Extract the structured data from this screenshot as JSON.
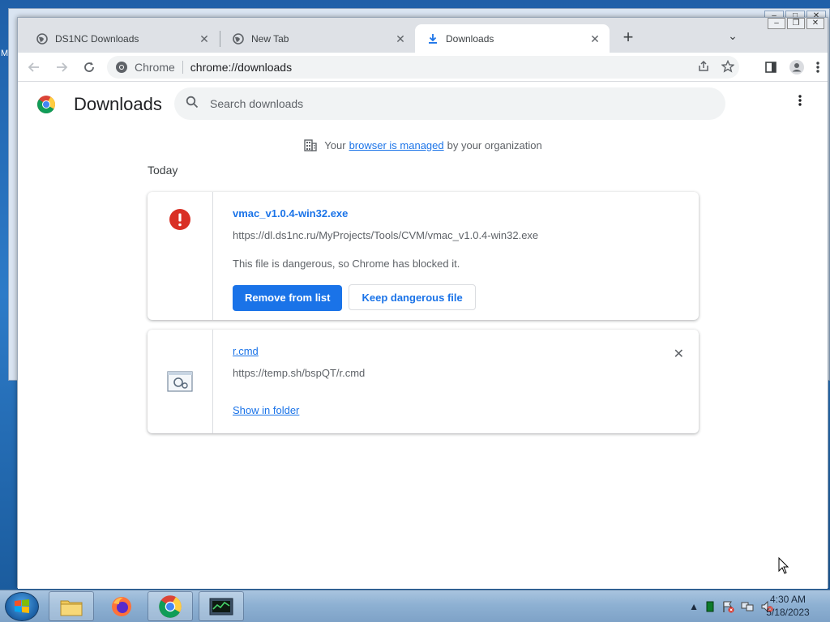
{
  "desktop": {
    "left_label": "M"
  },
  "browser": {
    "tabs": [
      {
        "title": "DS1NC Downloads",
        "icon": "globe-icon",
        "active": false
      },
      {
        "title": "New Tab",
        "icon": "globe-icon",
        "active": false
      },
      {
        "title": "Downloads",
        "icon": "download-icon",
        "active": true
      }
    ],
    "new_tab_label": "+",
    "tab_search_label": "⌄",
    "close_glyph": "✕"
  },
  "toolbar": {
    "site_chip": "Chrome",
    "url": "chrome://downloads"
  },
  "downloads": {
    "title": "Downloads",
    "search_placeholder": "Search downloads",
    "managed": {
      "prefix": "Your",
      "link": "browser is managed",
      "suffix": "by your organization"
    },
    "section_label": "Today",
    "items": [
      {
        "file_name": "vmac_v1.0.4-win32.exe",
        "url": "https://dl.ds1nc.ru/MyProjects/Tools/CVM/vmac_v1.0.4-win32.exe",
        "status": "This file is dangerous, so Chrome has blocked it.",
        "primary_action": "Remove from list",
        "secondary_action": "Keep dangerous file",
        "icon": "danger-icon"
      },
      {
        "file_name": "r.cmd",
        "url": "https://temp.sh/bspQT/r.cmd",
        "action": "Show in folder",
        "icon": "cmd-file-icon"
      }
    ]
  },
  "taskbar": {
    "clock_time": "4:30 AM",
    "clock_date": "5/18/2023",
    "apps": [
      "file-explorer-icon",
      "firefox-icon",
      "chrome-icon",
      "task-manager-icon"
    ]
  },
  "colors": {
    "accent": "#1a73e8",
    "danger": "#d93025"
  }
}
